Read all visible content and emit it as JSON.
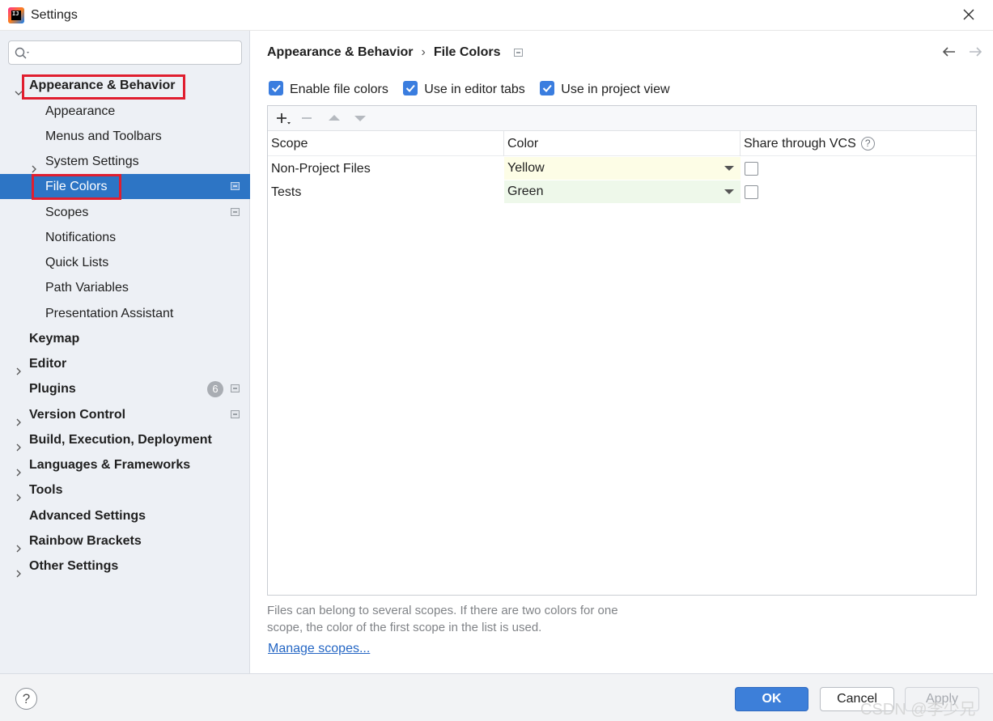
{
  "window": {
    "title": "Settings"
  },
  "search": {
    "placeholder": "",
    "value": ""
  },
  "sidebar": {
    "items": [
      {
        "label": "Appearance & Behavior"
      },
      {
        "label": "Appearance"
      },
      {
        "label": "Menus and Toolbars"
      },
      {
        "label": "System Settings"
      },
      {
        "label": "File Colors"
      },
      {
        "label": "Scopes"
      },
      {
        "label": "Notifications"
      },
      {
        "label": "Quick Lists"
      },
      {
        "label": "Path Variables"
      },
      {
        "label": "Presentation Assistant"
      },
      {
        "label": "Keymap"
      },
      {
        "label": "Editor"
      },
      {
        "label": "Plugins",
        "badge": "6"
      },
      {
        "label": "Version Control"
      },
      {
        "label": "Build, Execution, Deployment"
      },
      {
        "label": "Languages & Frameworks"
      },
      {
        "label": "Tools"
      },
      {
        "label": "Advanced Settings"
      },
      {
        "label": "Rainbow Brackets"
      },
      {
        "label": "Other Settings"
      }
    ]
  },
  "breadcrumb": {
    "parent": "Appearance & Behavior",
    "separator": "›",
    "current": "File Colors"
  },
  "options": {
    "enable_file_colors": {
      "label": "Enable file colors",
      "checked": true
    },
    "use_in_editor_tabs": {
      "label": "Use in editor tabs",
      "checked": true
    },
    "use_in_project_view": {
      "label": "Use in project view",
      "checked": true
    }
  },
  "table": {
    "columns": [
      "Scope",
      "Color",
      "Share through VCS"
    ],
    "help_glyph": "?",
    "rows": [
      {
        "scope": "Non-Project Files",
        "color": "Yellow",
        "color_bg": "#fdfde6",
        "shared": false
      },
      {
        "scope": "Tests",
        "color": "Green",
        "color_bg": "#eef8ea",
        "shared": false
      }
    ]
  },
  "note": {
    "line1": "Files can belong to several scopes. If there are two colors for one",
    "line2": "scope, the color of the first scope in the list is used."
  },
  "manage_link": "Manage scopes...",
  "footer": {
    "help": "?",
    "ok": "OK",
    "cancel": "Cancel",
    "apply": "Apply"
  },
  "watermark": "CSDN @李少兄",
  "colors": {
    "selection": "#2d75c5",
    "accent": "#3d7fd9",
    "highlight_box": "#e01e2f"
  }
}
